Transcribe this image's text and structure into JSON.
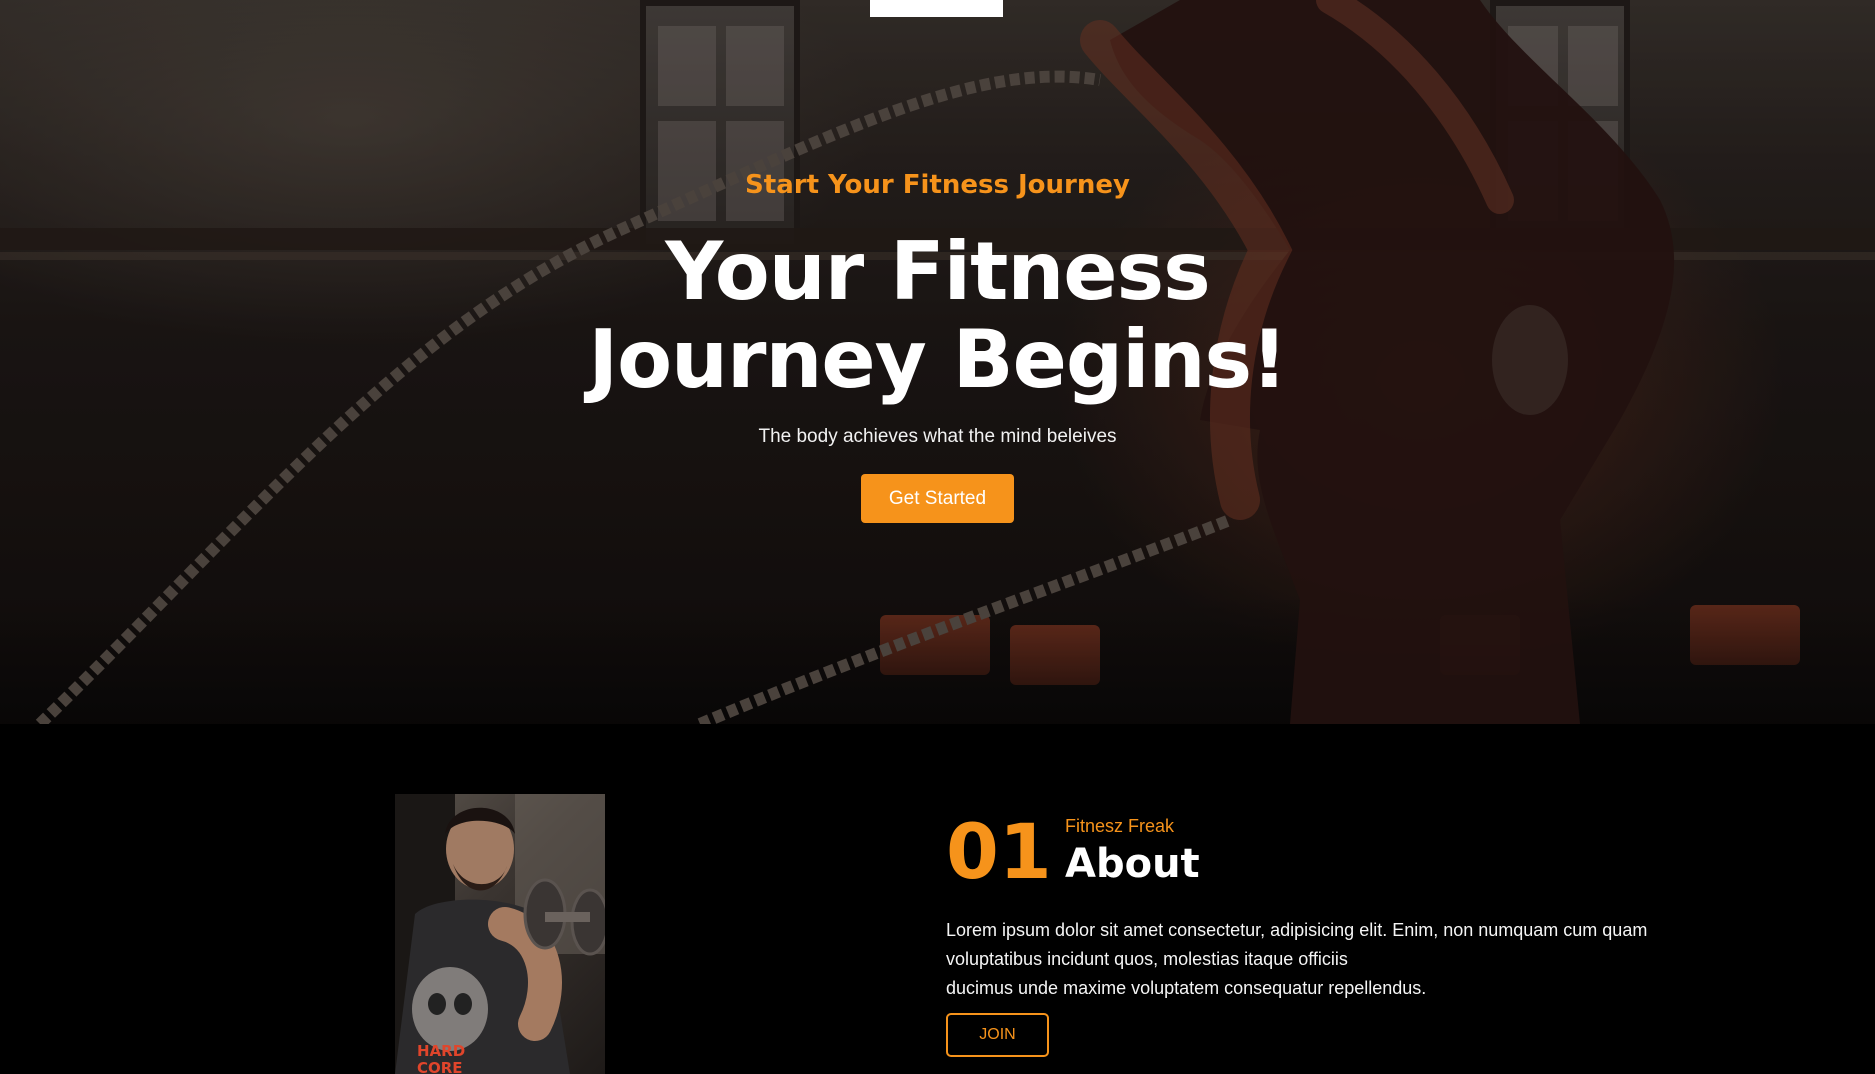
{
  "hero": {
    "eyebrow": "Start Your Fitness Journey",
    "headline_line1": "Your Fitness",
    "headline_line2": "Journey Begins!",
    "tagline": "The body achieves what the mind beleives",
    "cta_label": "Get Started",
    "background_image": "man-with-battle-ropes-photo"
  },
  "about": {
    "number": "01",
    "kicker": "Fitnesz Freak",
    "title": "About",
    "paragraph1": "Lorem ipsum dolor sit amet consectetur, adipisicing elit. Enim, non numquam cum quam voluptatibus incidunt quos, molestias itaque officiis",
    "paragraph2": "ducimus unde maxime voluptatem consequatur repellendus.",
    "join_label": "JOIN",
    "image": "man-lifting-dumbbell-photo"
  },
  "colors": {
    "accent": "#f6931b",
    "background": "#000000",
    "text": "#ffffff"
  }
}
